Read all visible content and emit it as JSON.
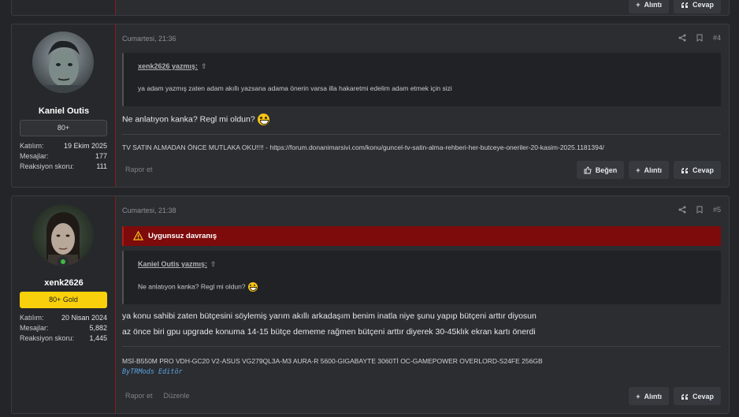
{
  "prev_post": {
    "like_label": "Alıntı",
    "reply_label": "Cevap"
  },
  "posts": [
    {
      "username": "Kaniel Outis",
      "rank": "80+",
      "stats": [
        {
          "label": "Katılım:",
          "value": "19 Ekim 2025"
        },
        {
          "label": "Mesajlar:",
          "value": "177"
        },
        {
          "label": "Reaksiyon skoru:",
          "value": "111"
        }
      ],
      "timestamp": "Cumartesi, 21:36",
      "post_number": "#4",
      "quote_author": "xenk2626 yazmış:",
      "quote_text": "ya adam yazmış zaten adam akıllı yazsana adama önerin varsa illa hakaretmi edelim adam etmek için sizi",
      "body": "Ne anlatıyon kanka? Regl mi oldun?",
      "signature": "TV SATIN ALMADAN ÖNCE MUTLAKA OKU!!!! - https://forum.donanimarsivi.com/konu/guncel-tv-satin-alma-rehberi-her-butceye-oneriler-20-kasim-2025.1181394/",
      "report_label": "Rapor et",
      "like_label": "Beğen",
      "quote_label": "Alıntı",
      "reply_label": "Cevap"
    },
    {
      "username": "xenk2626",
      "rank": "80+ Gold",
      "stats": [
        {
          "label": "Katılım:",
          "value": "20 Nisan 2024"
        },
        {
          "label": "Mesajlar:",
          "value": "5,882"
        },
        {
          "label": "Reaksiyon skoru:",
          "value": "1,445"
        }
      ],
      "timestamp": "Cumartesi, 21:38",
      "post_number": "#5",
      "warning": "Uygunsuz davranış",
      "quote_author": "Kaniel Outis yazmış:",
      "quote_text": "Ne anlatıyon kanka? Regl mi oldun?",
      "body_lines": [
        "ya konu sahibi zaten bütçesini söylemiş yarım akıllı arkadaşım benim inatla niye şunu yapıp bütçeni arttır diyosun",
        "az önce biri gpu upgrade konuma 14-15 bütçe dememe rağmen bütçeni arttır diyerek 30-45klık ekran kartı önerdi"
      ],
      "signature": "MSİ-B550M PRO VDH-GC20 V2-ASUS VG279QL3A-M3 AURA-R 5600-GIGABAYTE 3060Tİ OC-GAMEPOWER OVERLORD-S24FE 256GB",
      "signature2": "ByTRMods Editör",
      "report_label": "Rapor et",
      "edit_label": "Düzenle",
      "quote_label": "Alıntı",
      "reply_label": "Cevap"
    }
  ],
  "colors": {
    "accent_red": "#8a1a1a",
    "warning_bg": "#7d0b0b",
    "gold": "#f8d10c",
    "online": "#3fb93f"
  },
  "icons": [
    "share-icon",
    "bookmark-icon",
    "warning-icon",
    "arrow-up-icon",
    "thumbs-up-icon",
    "plus-icon",
    "quote-icon"
  ]
}
